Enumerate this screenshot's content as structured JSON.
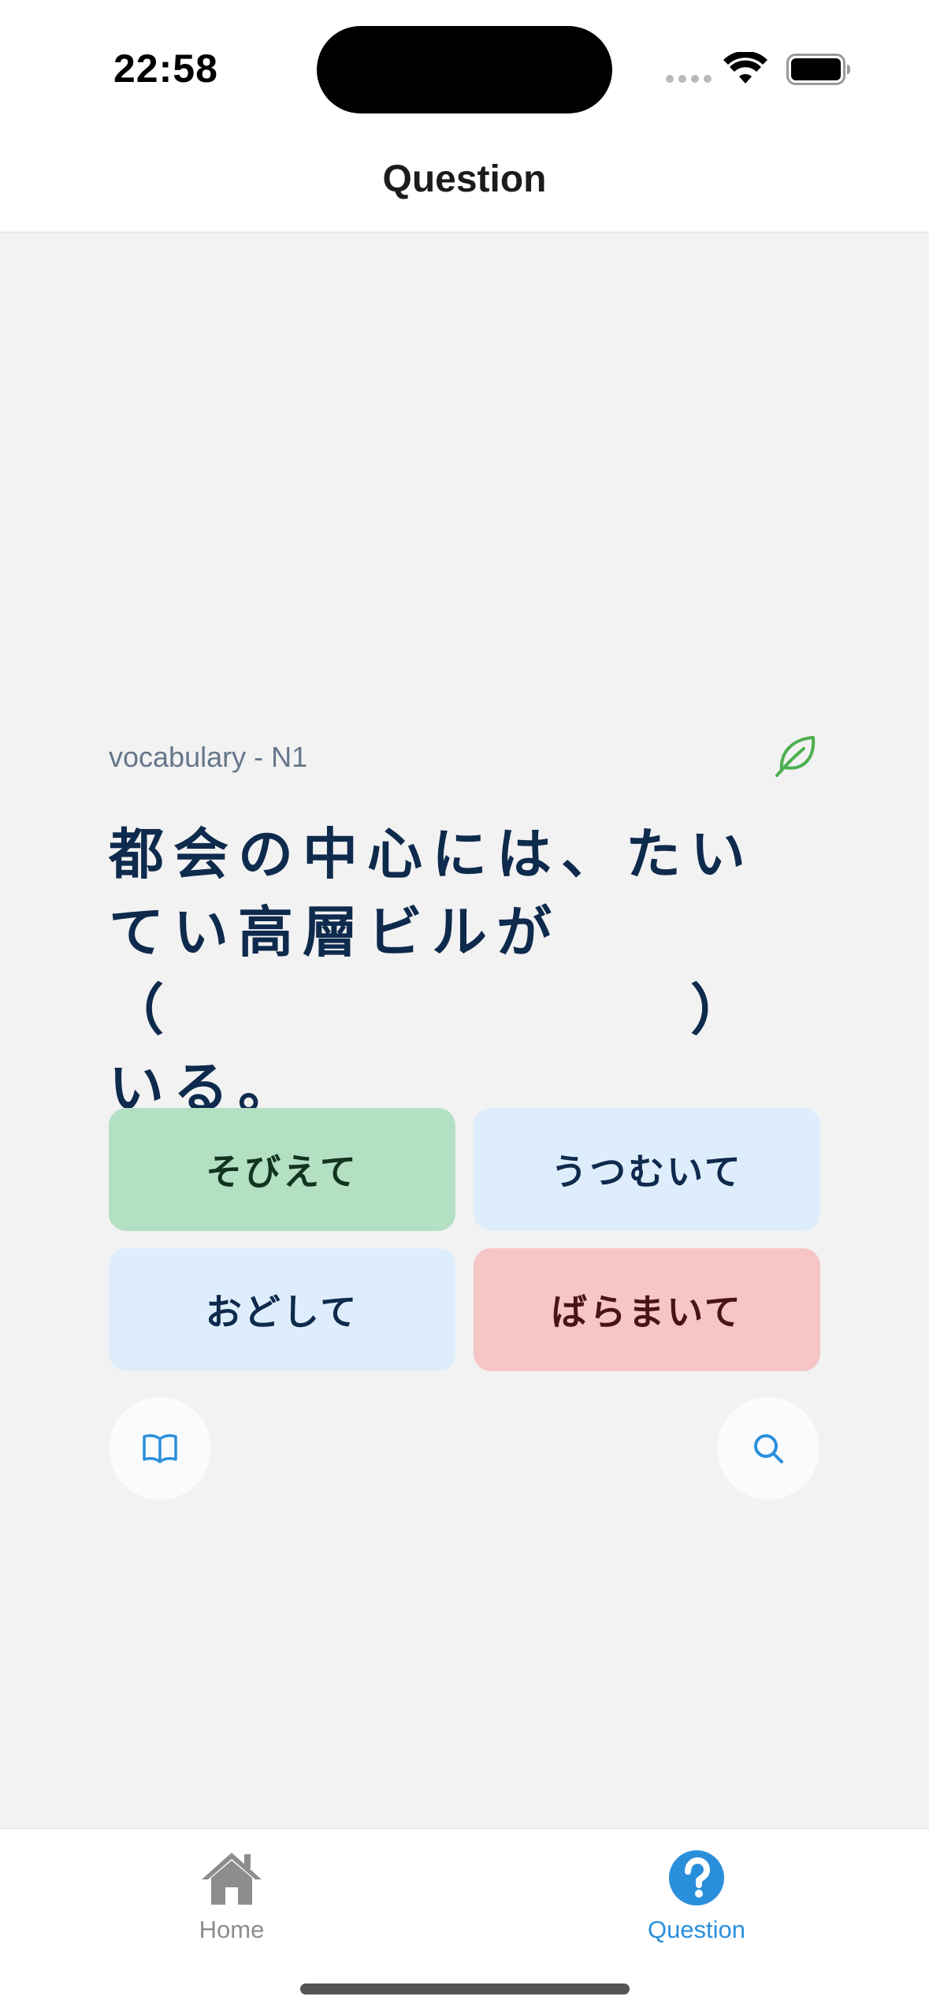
{
  "status_bar": {
    "time": "22:58"
  },
  "header": {
    "title": "Question"
  },
  "question": {
    "category": "vocabulary - N1",
    "text": "都会の中心には、たいてい高層ビルが\n（　　　　　　　　）いる。"
  },
  "answers": [
    {
      "label": "そびえて",
      "state": "correct",
      "color": "#b3dfc3"
    },
    {
      "label": "うつむいて",
      "state": "neutral",
      "color": "#deedfb"
    },
    {
      "label": "おどして",
      "state": "neutral",
      "color": "#deedfb"
    },
    {
      "label": "ばらまいて",
      "state": "wrong",
      "color": "#f6c6c6"
    }
  ],
  "actions": {
    "left_icon": "book-icon",
    "right_icon": "search-icon"
  },
  "tab_bar": {
    "tabs": [
      {
        "label": "Home",
        "icon": "home-icon",
        "active": false
      },
      {
        "label": "Question",
        "icon": "question-circle-icon",
        "active": true
      }
    ],
    "active_color": "#2a8fdb",
    "inactive_color": "#8d8d8d"
  }
}
